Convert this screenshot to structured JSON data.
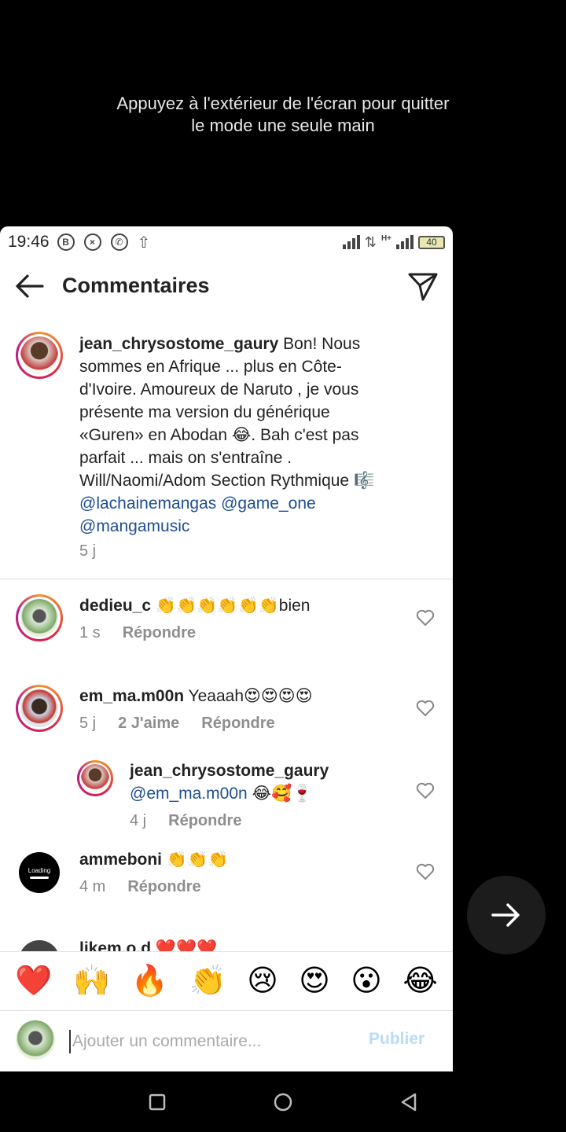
{
  "overlay": {
    "hint_line1": "Appuyez à l'extérieur de l'écran pour quitter",
    "hint_line2": "le mode une seule main"
  },
  "status": {
    "time": "19:46",
    "battery": "40",
    "network": "H+"
  },
  "header": {
    "title": "Commentaires"
  },
  "caption": {
    "username": "jean_chrysostome_gaury",
    "text": "Bon! Nous sommes en Afrique ... plus en Côte-d'Ivoire.  Amoureux de Naruto , je vous présente ma version du générique «Guren» en Abodan 😂. Bah c'est pas parfait ... mais on s'entraîne . Will/Naomi/Adom Section Rythmique 🎼 ",
    "mention1": "@lachainemangas",
    "mention2": "@game_one",
    "mention3": "@mangamusic",
    "time": "5 j"
  },
  "comments": [
    {
      "username": "dedieu_c",
      "text": "👏👏👏👏👏👏bien",
      "time": "1 s",
      "likes": "",
      "reply": "Répondre"
    },
    {
      "username": "em_ma.m00n",
      "text": "Yeaaah😍😍😍😍",
      "time": "5 j",
      "likes": "2 J'aime",
      "reply": "Répondre"
    },
    {
      "username": "jean_chrysostome_gaury",
      "mention": "@em_ma.m00n",
      "text": " 😂🥰🍷",
      "time": "4 j",
      "likes": "",
      "reply": "Répondre"
    },
    {
      "username": "ammeboni",
      "text": "👏👏👏",
      "time": "4 m",
      "likes": "",
      "reply": "Répondre"
    },
    {
      "username": "likem.o.d",
      "text": "❤️❤️❤️",
      "time": "",
      "likes": "",
      "reply": ""
    }
  ],
  "quick_emojis": [
    "❤️",
    "🙌",
    "🔥",
    "👏",
    "😢",
    "😍",
    "😮",
    "😂"
  ],
  "composer": {
    "placeholder": "Ajouter un commentaire...",
    "publish": "Publier"
  },
  "colors": {
    "mention": "#1e4f91",
    "publish_disabled": "#b9dcf7",
    "story_ring": "#dc2743"
  }
}
